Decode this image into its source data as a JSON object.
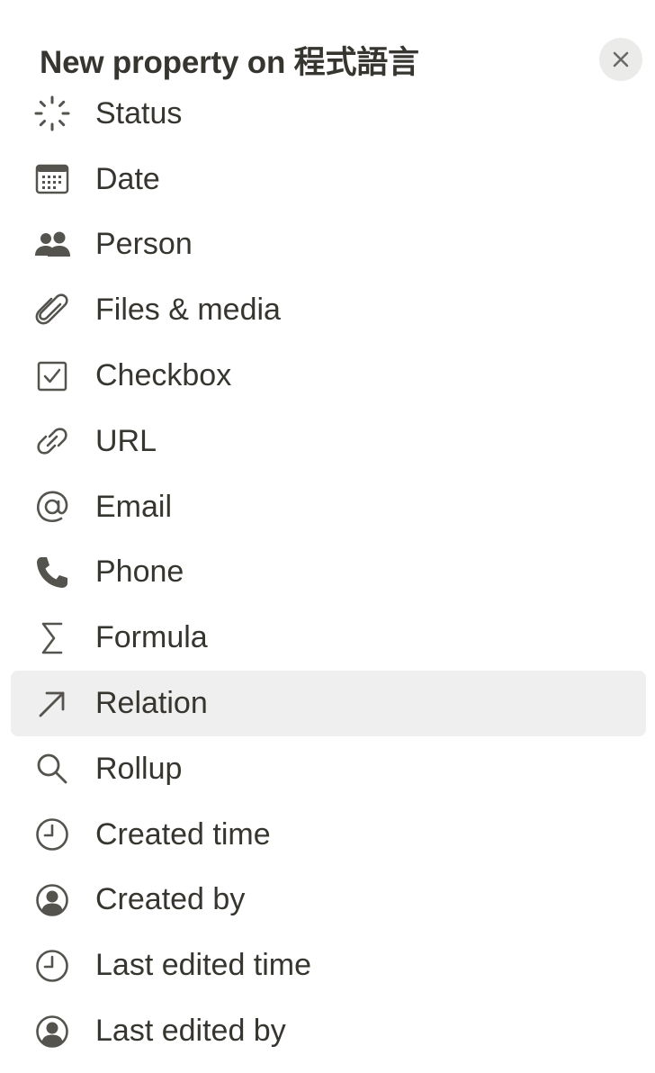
{
  "header": {
    "title": "New property on 程式語言",
    "close_icon": "close-icon"
  },
  "menu": {
    "selected": "Relation",
    "items": [
      {
        "label": "Status",
        "icon": "status-icon"
      },
      {
        "label": "Date",
        "icon": "calendar-icon"
      },
      {
        "label": "Person",
        "icon": "people-icon"
      },
      {
        "label": "Files & media",
        "icon": "paperclip-icon"
      },
      {
        "label": "Checkbox",
        "icon": "checkbox-icon"
      },
      {
        "label": "URL",
        "icon": "link-icon"
      },
      {
        "label": "Email",
        "icon": "at-sign-icon"
      },
      {
        "label": "Phone",
        "icon": "phone-icon"
      },
      {
        "label": "Formula",
        "icon": "sigma-icon"
      },
      {
        "label": "Relation",
        "icon": "arrow-up-right-icon"
      },
      {
        "label": "Rollup",
        "icon": "search-icon"
      },
      {
        "label": "Created time",
        "icon": "clock-icon"
      },
      {
        "label": "Created by",
        "icon": "user-circle-icon"
      },
      {
        "label": "Last edited time",
        "icon": "clock-icon"
      },
      {
        "label": "Last edited by",
        "icon": "user-circle-icon"
      }
    ]
  },
  "colors": {
    "text": "#37352f",
    "icon": "#55534e",
    "selected_bg": "#efefef",
    "close_bg": "#ebebea"
  }
}
